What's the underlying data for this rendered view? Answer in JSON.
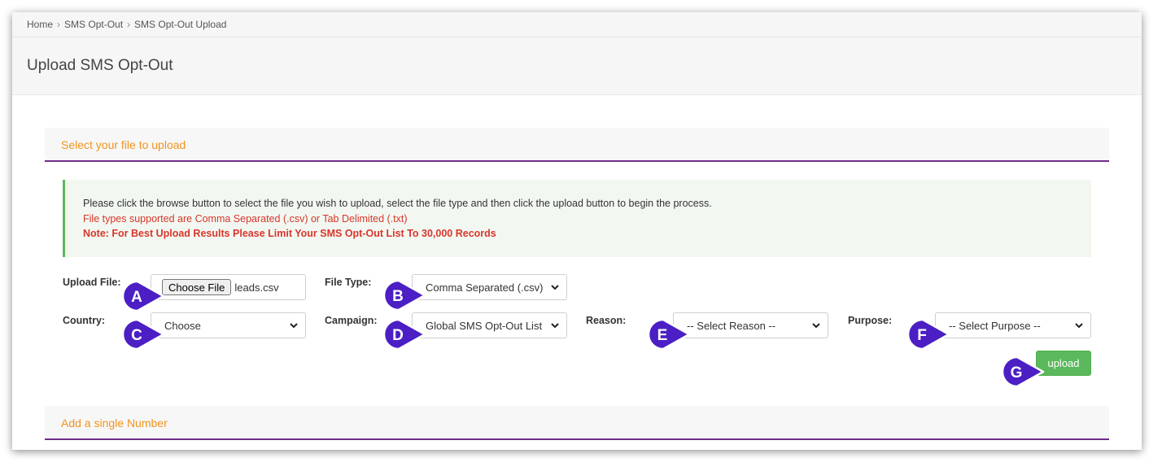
{
  "breadcrumb": {
    "items": [
      "Home",
      "SMS Opt-Out",
      "SMS Opt-Out Upload"
    ],
    "separator": "›"
  },
  "page": {
    "title": "Upload SMS Opt-Out"
  },
  "upload_panel": {
    "heading": "Select your file to upload",
    "info": {
      "line1": "Please click the browse button to select the file you wish to upload, select the file type and then click the upload button to begin the process.",
      "line2": "File types supported are Comma Separated (.csv) or Tab Delimited (.txt)",
      "line3": "Note: For Best Upload Results Please Limit Your SMS Opt-Out List To 30,000 Records"
    },
    "form": {
      "upload_file": {
        "label": "Upload File:",
        "button": "Choose File",
        "value": "leads.csv"
      },
      "file_type": {
        "label": "File Type:",
        "value": "Comma Separated (.csv)"
      },
      "country": {
        "label": "Country:",
        "value": "Choose"
      },
      "campaign": {
        "label": "Campaign:",
        "value": "Global SMS Opt-Out List"
      },
      "reason": {
        "label": "Reason:",
        "value": "-- Select Reason --"
      },
      "purpose": {
        "label": "Purpose:",
        "value": "-- Select Purpose --"
      },
      "submit": {
        "label": "upload"
      }
    }
  },
  "single_panel": {
    "heading": "Add a single Number"
  },
  "markers": [
    "A",
    "B",
    "C",
    "D",
    "E",
    "F",
    "G"
  ],
  "colors": {
    "accent_orange": "#f0931e",
    "heading_rule": "#6d2e8c",
    "info_green": "#5cb85c",
    "info_red": "#d9352b",
    "button_green": "#5cb85c",
    "marker_purple": "#4b1fc4"
  },
  "icons": {
    "select_arrow": "chevron-down-icon",
    "marker": "callout-marker-icon"
  }
}
